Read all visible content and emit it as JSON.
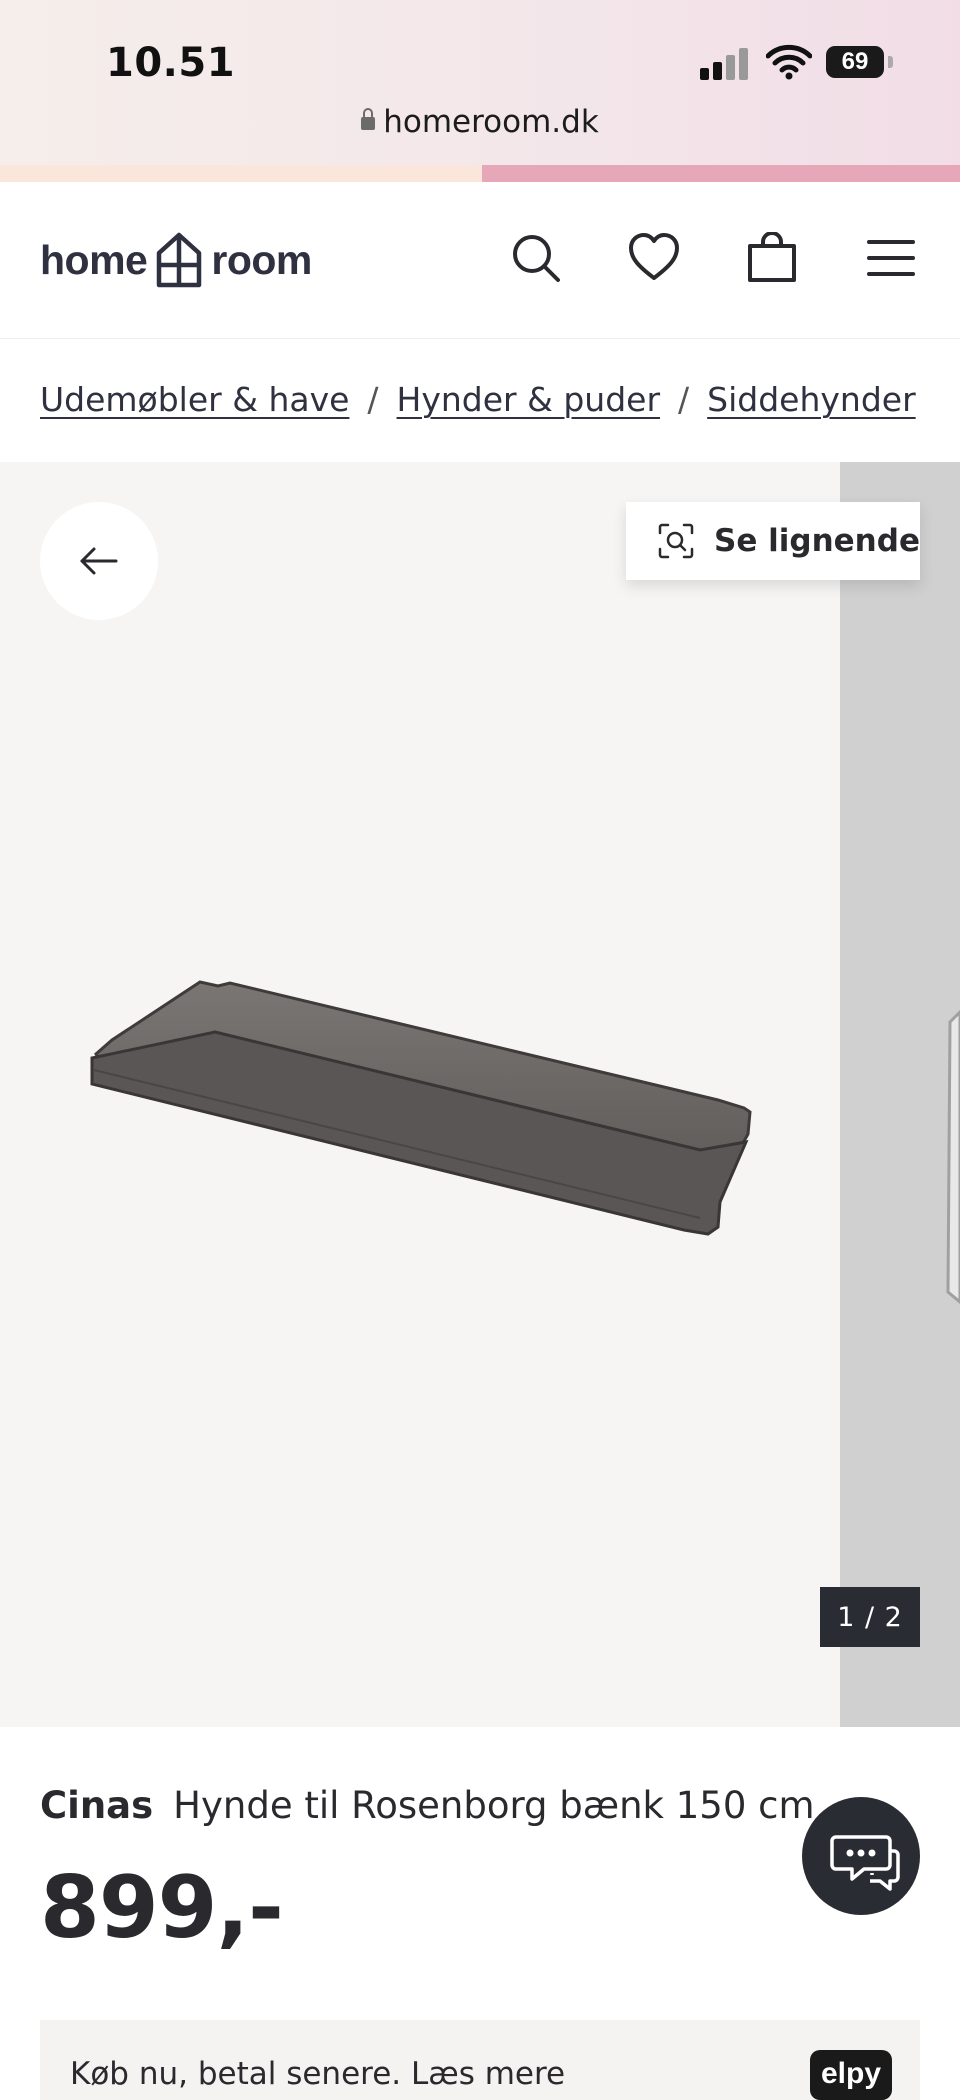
{
  "status": {
    "time": "10.51",
    "battery": "69"
  },
  "browser": {
    "url": "homeroom.dk"
  },
  "header": {
    "logo_left": "home",
    "logo_right": "room"
  },
  "breadcrumb": [
    "Udemøbler & have",
    "Hynder & puder",
    "Siddehynder"
  ],
  "breadcrumb_separator": "/",
  "gallery": {
    "similar_label": "Se lignende",
    "counter": "1 / 2"
  },
  "product": {
    "brand": "Cinas",
    "name": "Hynde til Rosenborg bænk 150 cm",
    "price": "899,-"
  },
  "promo": {
    "text": "Køb nu, betal senere. Læs mere",
    "badge": "elpy"
  },
  "colors": {
    "accent_dark": "#2a2c33",
    "gallery_bg": "#f6f5f4",
    "cushion": "#6e6a68"
  }
}
